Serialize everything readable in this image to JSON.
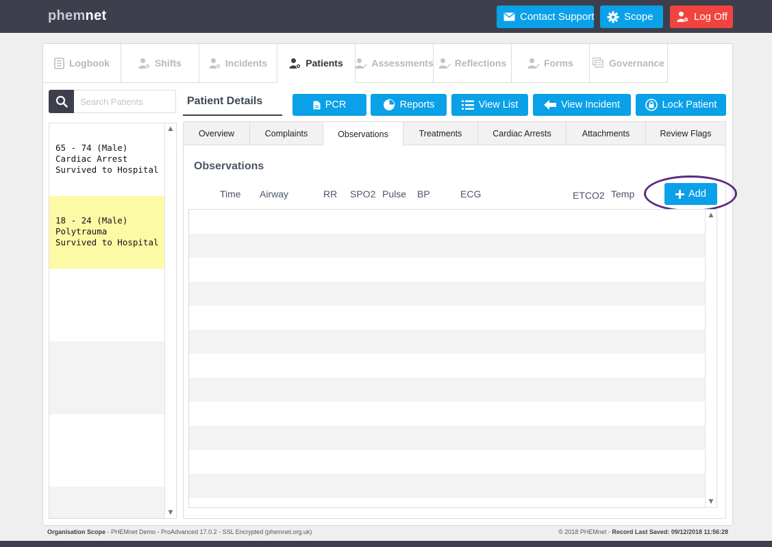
{
  "app": {
    "logo_light": "phem",
    "logo_bold": "net"
  },
  "topbar": {
    "contact_support": "Contact Support",
    "scope": "Scope",
    "log_off": "Log Off"
  },
  "modules": [
    {
      "label": "Logbook",
      "icon": "logbook-icon"
    },
    {
      "label": "Shifts",
      "icon": "user-gear-icon"
    },
    {
      "label": "Incidents",
      "icon": "user-gear-icon"
    },
    {
      "label": "Patients",
      "icon": "user-gear-icon",
      "active": true
    },
    {
      "label": "Assessments",
      "icon": "user-pen-icon"
    },
    {
      "label": "Reflections",
      "icon": "user-pen-icon"
    },
    {
      "label": "Forms",
      "icon": "user-pen-icon"
    },
    {
      "label": "Governance",
      "icon": "governance-icon"
    }
  ],
  "search": {
    "placeholder": "Search Patients"
  },
  "patients": [
    {
      "line1": "65 - 74 (Male)",
      "line2": "Cardiac Arrest",
      "line3": "Survived to Hospital",
      "selected": false
    },
    {
      "line1": "18 - 24 (Male)",
      "line2": "Polytrauma",
      "line3": "Survived to Hospital",
      "selected": true
    }
  ],
  "details": {
    "title": "Patient Details",
    "actions": {
      "pcr": "PCR",
      "reports": "Reports",
      "view_list": "View List",
      "view_incident": "View Incident",
      "lock_patient": "Lock Patient"
    },
    "tabs": [
      "Overview",
      "Complaints",
      "Observations",
      "Treatments",
      "Cardiac Arrests",
      "Attachments",
      "Review Flags"
    ],
    "active_tab": "Observations"
  },
  "observations": {
    "title": "Observations",
    "columns": [
      "Time",
      "Airway",
      "RR",
      "SPO2",
      "Pulse",
      "BP",
      "ECG",
      "ETCO2",
      "Temp"
    ],
    "add_label": "Add",
    "rows": []
  },
  "footer": {
    "scope_label": "Organisation Scope",
    "scope_text": " - PHEMnet Demo - ProAdvanced 17.0.2 - SSL Encrypted (phemnet.org.uk)",
    "copyright": "© 2018 PHEMnet - ",
    "saved_label": "Record Last Saved: 09/12/2018 11:56:28"
  },
  "colors": {
    "accent": "#0aa1e8",
    "danger": "#f2443e",
    "dark": "#3d3f4d",
    "selected_row": "#fdfaa6",
    "highlight_ring": "#5a2a7a"
  }
}
